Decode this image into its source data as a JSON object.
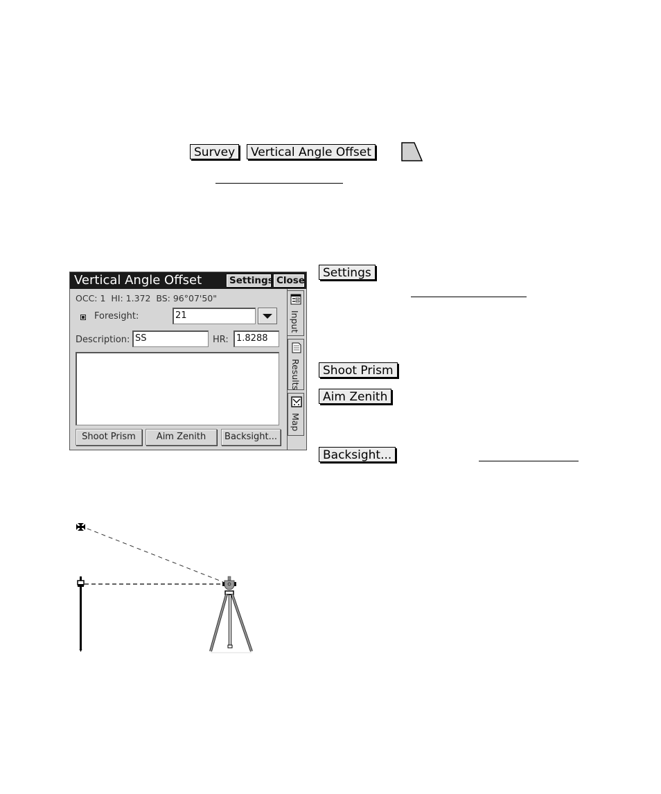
{
  "breadcrumb": {
    "menu_key": "Survey",
    "item_key": "Vertical Angle Offset",
    "icon": "softkey-trapezoid-icon"
  },
  "window": {
    "title": "Vertical Angle Offset",
    "settings_label": "Settings",
    "close_label": "Close",
    "info_line": "OCC: 1  HI: 1.372  BS: 96°07'50\"",
    "foresight_label": "Foresight:",
    "foresight_value": "21",
    "description_label": "Description:",
    "description_value": "SS",
    "hr_label": "HR:",
    "hr_value": "1.8288",
    "buttons": {
      "shoot_prism": "Shoot Prism",
      "aim_zenith": "Aim Zenith",
      "backsight": "Backsight..."
    },
    "tabs": [
      {
        "label": "Input",
        "icon": "input-form-icon",
        "active": true
      },
      {
        "label": "Results",
        "icon": "results-document-icon",
        "active": false
      },
      {
        "label": "Map",
        "icon": "map-icon",
        "active": false
      }
    ]
  },
  "side_keys": {
    "settings": "Settings",
    "shoot_prism": "Shoot Prism",
    "aim_zenith": "Aim Zenith",
    "backsight": "Backsight..."
  },
  "diagram": {
    "elements": [
      "zenith-target",
      "prism-pole",
      "total-station-tripod"
    ],
    "lines": [
      "sight-line-to-zenith (dashed)",
      "horizontal-sight-line (dashed)"
    ]
  }
}
